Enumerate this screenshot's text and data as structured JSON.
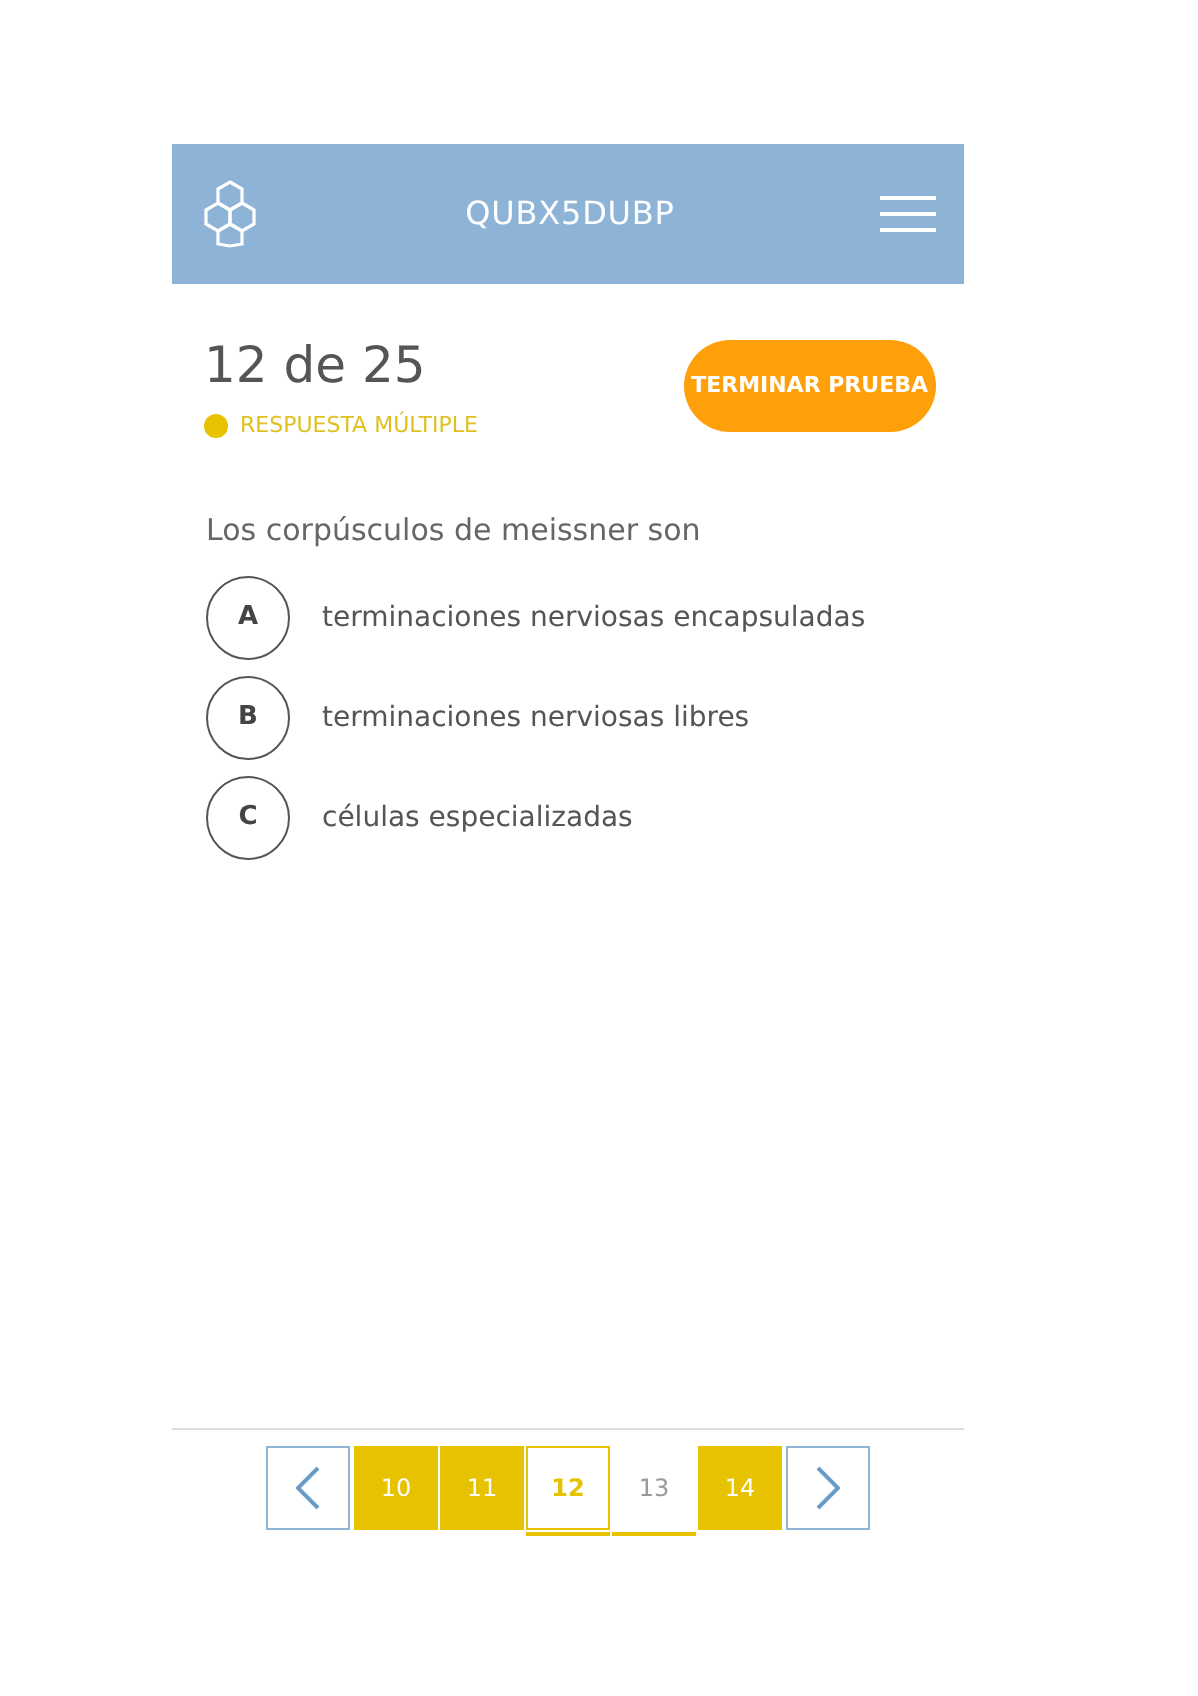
{
  "header": {
    "title": "QUBX5DUBP"
  },
  "progress": {
    "text": "12 de 25"
  },
  "question_type": {
    "label": "RESPUESTA MÚLTIPLE",
    "color": "#e6c200"
  },
  "finish_button": {
    "label": "TERMINAR PRUEBA"
  },
  "question": {
    "text": "Los corpúsculos de meissner son"
  },
  "options": [
    {
      "letter": "A",
      "text": "terminaciones nerviosas encapsuladas"
    },
    {
      "letter": "B",
      "text": "terminaciones nerviosas libres"
    },
    {
      "letter": "C",
      "text": "células especializadas"
    }
  ],
  "pagination": [
    {
      "label": "10",
      "answered": true,
      "selected": false
    },
    {
      "label": "11",
      "answered": true,
      "selected": false
    },
    {
      "label": "12",
      "answered": false,
      "selected": true
    },
    {
      "label": "13",
      "answered": false,
      "selected": false
    },
    {
      "label": "14",
      "answered": true,
      "selected": false
    }
  ]
}
